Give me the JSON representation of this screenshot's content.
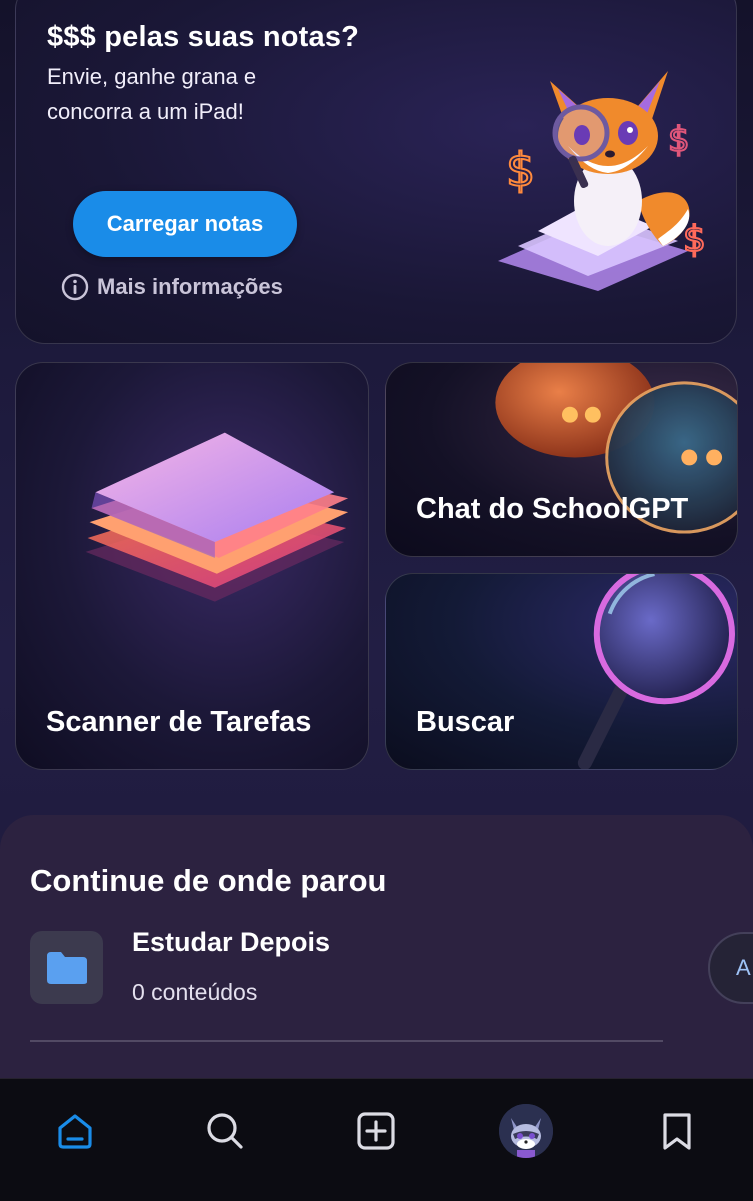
{
  "promo": {
    "title": "$$$ pelas suas notas?",
    "subtitle": "Envie, ganhe grana e concorra a um iPad!",
    "upload_label": "Carregar notas",
    "more_info_label": "Mais informações"
  },
  "cards": {
    "scanner_label": "Scanner de Tarefas",
    "chat_label": "Chat do SchoolGPT",
    "search_label": "Buscar"
  },
  "continue": {
    "title": "Continue de onde parou",
    "item_title": "Estudar Depois",
    "item_count": "0 conteúdos",
    "side_pill_text": "A"
  },
  "navbar": {
    "items": [
      "home-icon",
      "search-icon",
      "add-icon",
      "avatar",
      "bookmark-icon"
    ],
    "active": "home",
    "accent": "#1a8ce8"
  },
  "colors": {
    "accent": "#1a8ce8",
    "background": "#1d1a3c",
    "panel": "#2c2240"
  }
}
